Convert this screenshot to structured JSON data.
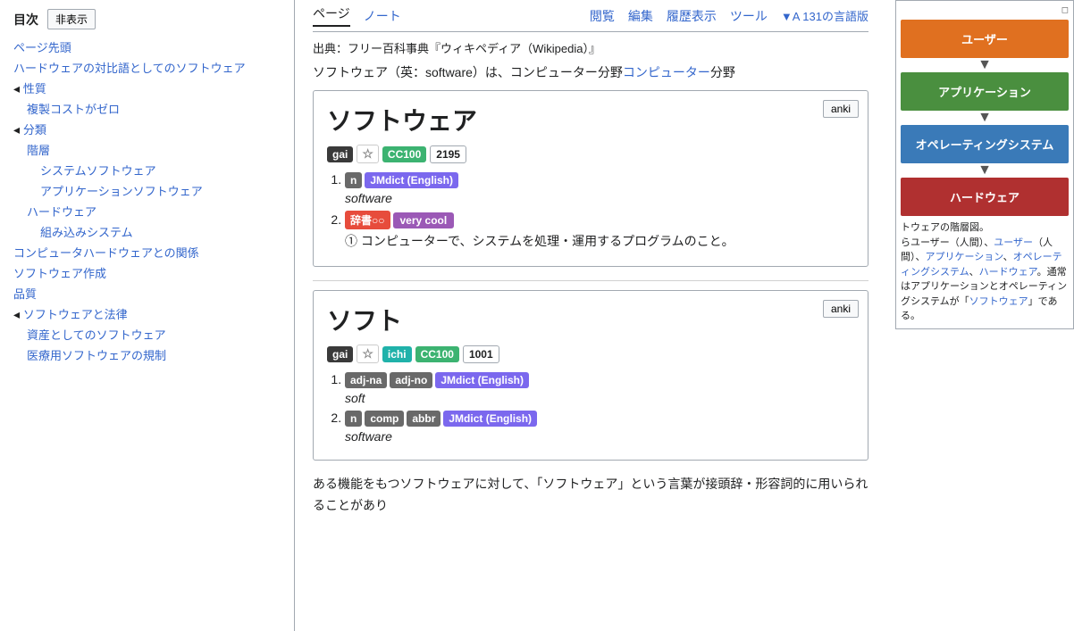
{
  "sidebar": {
    "toc_title": "目次",
    "hide_btn": "非表示",
    "items": [
      {
        "label": "ページ先頭",
        "level": "l1",
        "href": "#"
      },
      {
        "label": "ハードウェアの対比語としてのソフトウェア",
        "level": "l1",
        "href": "#"
      },
      {
        "label": "性質",
        "level": "l1",
        "href": "#"
      },
      {
        "label": "複製コストがゼロ",
        "level": "l2",
        "href": "#"
      },
      {
        "label": "分類",
        "level": "l1",
        "href": "#"
      },
      {
        "label": "階層",
        "level": "l2",
        "href": "#"
      },
      {
        "label": "システムソフトウェア",
        "level": "l3",
        "href": "#"
      },
      {
        "label": "アプリケーションソフトウェア",
        "level": "l3",
        "href": "#"
      },
      {
        "label": "ハードウェア",
        "level": "l2",
        "href": "#"
      },
      {
        "label": "組み込みシステム",
        "level": "l3",
        "href": "#"
      },
      {
        "label": "コンピュータハードウェアとの関係",
        "level": "l1",
        "href": "#"
      },
      {
        "label": "ソフトウェア作成",
        "level": "l1",
        "href": "#"
      },
      {
        "label": "品質",
        "level": "l1",
        "href": "#"
      },
      {
        "label": "ソフトウェアと法律",
        "level": "l1",
        "href": "#"
      },
      {
        "label": "資産としてのソフトウェア",
        "level": "l2",
        "href": "#"
      },
      {
        "label": "医療用ソフトウェアの規制",
        "level": "l2",
        "href": "#"
      }
    ]
  },
  "topbar": {
    "page_label": "ページ",
    "note_label": "ノート",
    "view_label": "閲覧",
    "edit_label": "編集",
    "history_label": "履歴表示",
    "tools_label": "ツール",
    "lang_label": "▼A 131の言語版"
  },
  "page": {
    "title": "ソフトウェア",
    "source": "出典：フリー百科事典『ウィキペディア（Wikipedia）』",
    "intro": "ソフトウェア（英：software）は、コンピューター分野"
  },
  "entry1": {
    "title": "ソフトウェア",
    "anki_btn": "anki",
    "badges": {
      "gai": "gai",
      "star": "☆",
      "cc100": "CC100",
      "count": "2195"
    },
    "definitions": [
      {
        "number": 1,
        "badges": [
          "n",
          "JMdict (English)"
        ],
        "reading": "software"
      },
      {
        "number": 2,
        "badges_special": true,
        "jisho": "辞書",
        "circles": "○○",
        "verycool": "very cool",
        "def": "① コンピューターで、システムを処理・運用するプログラムのこと。"
      }
    ]
  },
  "entry2": {
    "title": "ソフト",
    "anki_btn": "anki",
    "badges": {
      "gai": "gai",
      "star": "☆",
      "ichi": "ichi",
      "cc100": "CC100",
      "count": "1001"
    },
    "definitions": [
      {
        "number": 1,
        "badges": [
          "adj-na",
          "adj-no",
          "JMdict (English)"
        ],
        "reading": "soft"
      },
      {
        "number": 2,
        "badges": [
          "n",
          "comp",
          "abbr",
          "JMdict (English)"
        ],
        "reading": "software"
      }
    ]
  },
  "bottom_text": "ある機能をもつソフトウェアに対して、「ソフトウェア」という言葉が接頭辞・形容詞的に用いられることがあり",
  "diagram": {
    "user_label": "ユーザー",
    "app_label": "アプリケーション",
    "os_label": "オペレーティングシステム",
    "hw_label": "ハードウェア",
    "caption": "トウェアの階層図。らユーザー（人間）、リケーション、オペィングシステム、ハーェア。通常はアプリケョンとオペレーティングシステムが「ソフトウェア」である。",
    "caption_links": [
      "ユーザー",
      "アプリケーション",
      "オペレーティングシステム",
      "ハードウェア",
      "ソフトウェア"
    ]
  }
}
